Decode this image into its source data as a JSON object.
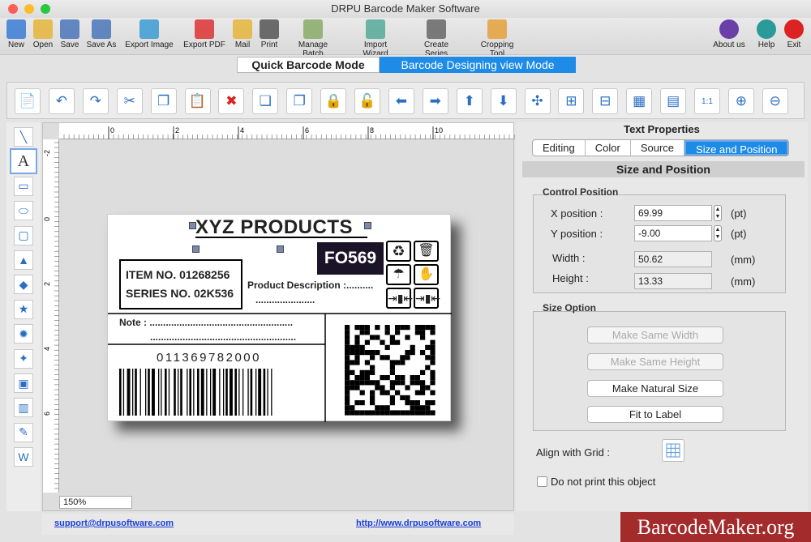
{
  "window": {
    "title": "DRPU Barcode Maker Software"
  },
  "menu": [
    {
      "label": "New",
      "icon": "new-icon",
      "color": "#3b7bd4"
    },
    {
      "label": "Open",
      "icon": "open-icon",
      "color": "#e5b43b"
    },
    {
      "label": "Save",
      "icon": "save-icon",
      "color": "#4a74b8"
    },
    {
      "label": "Save As",
      "icon": "save-as-icon",
      "color": "#4a74b8"
    },
    {
      "label": "Export Image",
      "icon": "export-image-icon",
      "color": "#3b9bd4"
    },
    {
      "label": "Export PDF",
      "icon": "export-pdf-icon",
      "color": "#d33"
    },
    {
      "label": "Mail",
      "icon": "mail-icon",
      "color": "#e5b43b"
    },
    {
      "label": "Print",
      "icon": "print-icon",
      "color": "#555"
    },
    {
      "label": "Manage Batch",
      "icon": "manage-batch-icon",
      "color": "#8a6"
    },
    {
      "label": "Import Wizard",
      "icon": "import-wizard-icon",
      "color": "#5a9"
    },
    {
      "label": "Create Series",
      "icon": "create-series-icon",
      "color": "#666"
    },
    {
      "label": "Cropping Tool",
      "icon": "cropping-tool-icon",
      "color": "#e5a03b"
    }
  ],
  "menu_right": [
    {
      "label": "About us",
      "icon": "about-icon",
      "color": "#6a3fa8"
    },
    {
      "label": "Help",
      "icon": "help-icon",
      "color": "#2a9a9a"
    },
    {
      "label": "Exit",
      "icon": "exit-icon",
      "color": "#d22"
    }
  ],
  "modes": {
    "quick": "Quick Barcode Mode",
    "designing": "Barcode Designing view Mode"
  },
  "toolbar_icons": [
    "properties-icon",
    "undo-icon",
    "redo-icon",
    "cut-icon",
    "copy-icon",
    "paste-icon",
    "delete-icon",
    "bring-front-icon",
    "send-back-icon",
    "lock-icon",
    "unlock-icon",
    "move-left-icon",
    "move-right-icon",
    "move-up-icon",
    "move-down-icon",
    "center-icon",
    "align-horizontal-icon",
    "align-vertical-icon",
    "grid-icon",
    "ruler-icon",
    "actual-size-icon",
    "zoom-in-icon",
    "zoom-out-icon"
  ],
  "tool_icons": [
    "line-tool-icon",
    "text-tool-icon",
    "rectangle-tool-icon",
    "ellipse-tool-icon",
    "rounded-rectangle-tool-icon",
    "triangle-tool-icon",
    "diamond-tool-icon",
    "star-tool-icon",
    "burst-tool-icon",
    "cross-star-tool-icon",
    "image-tool-icon",
    "barcode-tool-icon",
    "signature-tool-icon",
    "watermark-tool-icon"
  ],
  "canvas": {
    "zoom": "150%",
    "ruler_top": [
      "0",
      "2",
      "4",
      "6",
      "8",
      "10"
    ],
    "ruler_left": [
      "-2",
      "0",
      "2",
      "4",
      "6"
    ],
    "label": {
      "title": "XYZ PRODUCTS",
      "code": "FO569",
      "item_no": "ITEM NO. 01268256",
      "series_no": "SERIES NO. 02K536",
      "product_desc": "Product Description :..........",
      "product_desc_dots": "......................",
      "note": "Note : .....................................................",
      "note_dots": "......................................................",
      "barcode_number": "011369782000"
    }
  },
  "footer": {
    "email": "support@drpusoftware.com",
    "url": "http://www.drpusoftware.com"
  },
  "properties": {
    "heading": "Text Properties",
    "tabs": [
      "Editing",
      "Color",
      "Source",
      "Size and Position"
    ],
    "active_tab": "Size and Position",
    "section_title": "Size and Position",
    "control_position": {
      "legend": "Control Position",
      "x_label": "X position :",
      "x_value": "69.99",
      "x_unit": "(pt)",
      "y_label": "Y position :",
      "y_value": "-9.00",
      "y_unit": "(pt)",
      "width_label": "Width :",
      "width_value": "50.62",
      "width_unit": "(mm)",
      "height_label": "Height :",
      "height_value": "13.33",
      "height_unit": "(mm)"
    },
    "size_option": {
      "legend": "Size Option",
      "same_width": "Make Same Width",
      "same_height": "Make Same Height",
      "natural": "Make Natural Size",
      "fit": "Fit to Label"
    },
    "align_grid": "Align with Grid :",
    "no_print": "Do not print this object",
    "no_print_checked": false
  },
  "watermark": "BarcodeMaker.org"
}
